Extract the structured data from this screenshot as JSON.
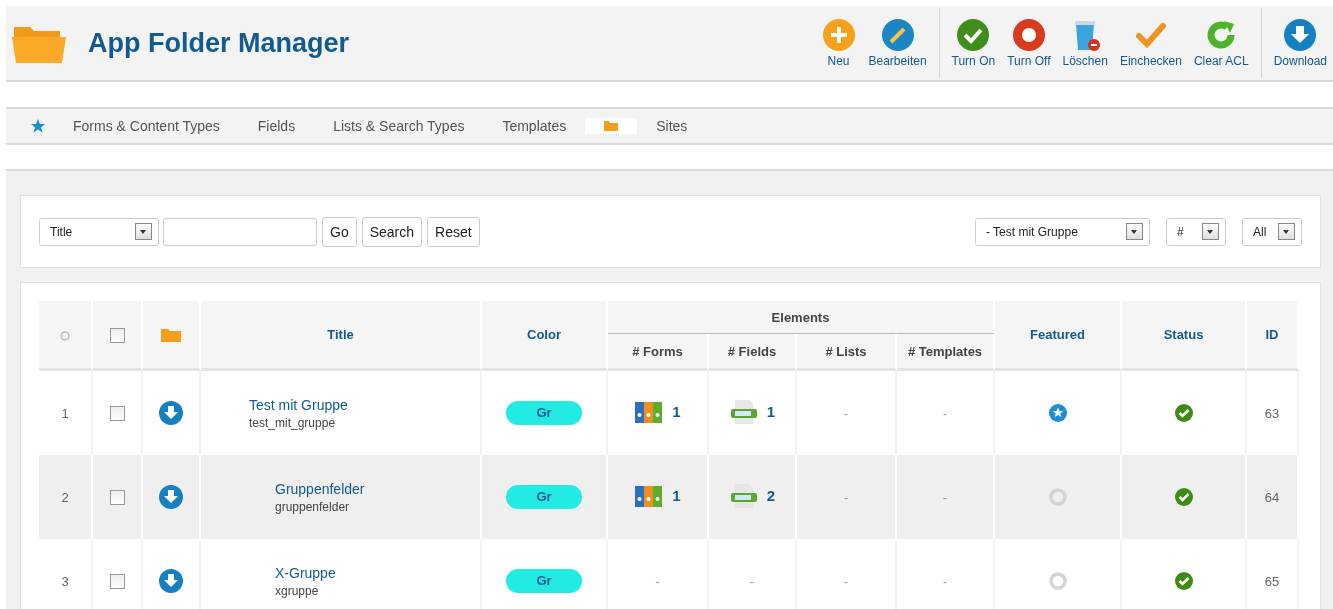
{
  "header": {
    "title": "App Folder Manager"
  },
  "toolbar": [
    [
      {
        "label": "Neu",
        "kind": "new"
      },
      {
        "label": "Bearbeiten",
        "kind": "edit"
      }
    ],
    [
      {
        "label": "Turn On",
        "kind": "on"
      },
      {
        "label": "Turn Off",
        "kind": "off"
      },
      {
        "label": "Löschen",
        "kind": "delete"
      },
      {
        "label": "Einchecken",
        "kind": "checkin"
      },
      {
        "label": "Clear ACL",
        "kind": "refresh"
      }
    ],
    [
      {
        "label": "Download",
        "kind": "download"
      }
    ]
  ],
  "nav": [
    {
      "kind": "star",
      "selected": false
    },
    {
      "kind": "text",
      "label": "Forms & Content Types",
      "selected": false
    },
    {
      "kind": "text",
      "label": "Fields",
      "selected": false
    },
    {
      "kind": "text",
      "label": "Lists & Search Types",
      "selected": false
    },
    {
      "kind": "text",
      "label": "Templates",
      "selected": false
    },
    {
      "kind": "folder",
      "selected": true
    },
    {
      "kind": "text",
      "label": "Sites",
      "selected": false
    }
  ],
  "filter": {
    "field_select": "Title",
    "buttons": [
      "Go",
      "Search",
      "Reset"
    ],
    "selects": [
      "- Test mit Gruppe",
      "#",
      "All"
    ]
  },
  "table": {
    "check_all": false,
    "columns": {
      "title": "Title",
      "tag_heading": "Color",
      "elements": "Elements",
      "forms": "# Forms",
      "fields": "# Fields",
      "lists": "# Lists",
      "templates": "# Templates",
      "featured": "Featured",
      "status": "Status",
      "id": "ID"
    },
    "rows": [
      {
        "number": "1",
        "checked": false,
        "title": "Test mit Gruppe",
        "alias": "test_mit_gruppe",
        "badge": "Gr",
        "color": "#22ebe4",
        "forms": "1",
        "fields": "1",
        "lists": "-",
        "templates": "-",
        "featured": true,
        "published": true,
        "id": "63",
        "children": [
          {
            "number": "2",
            "checked": false,
            "title": "Gruppenfelder",
            "alias": "gruppenfelder",
            "badge": "Gr",
            "color": "#22ebe4",
            "forms": "1",
            "fields": "2",
            "lists": "-",
            "templates": "-",
            "featured": false,
            "published": true,
            "id": "64"
          },
          {
            "number": "3",
            "checked": false,
            "title": "X-Gruppe",
            "alias": "xgruppe",
            "badge": "Gr",
            "color": "#22ebe4",
            "forms": "-",
            "fields": "-",
            "lists": "-",
            "templates": "-",
            "featured": false,
            "published": true,
            "id": "65"
          }
        ]
      }
    ]
  }
}
